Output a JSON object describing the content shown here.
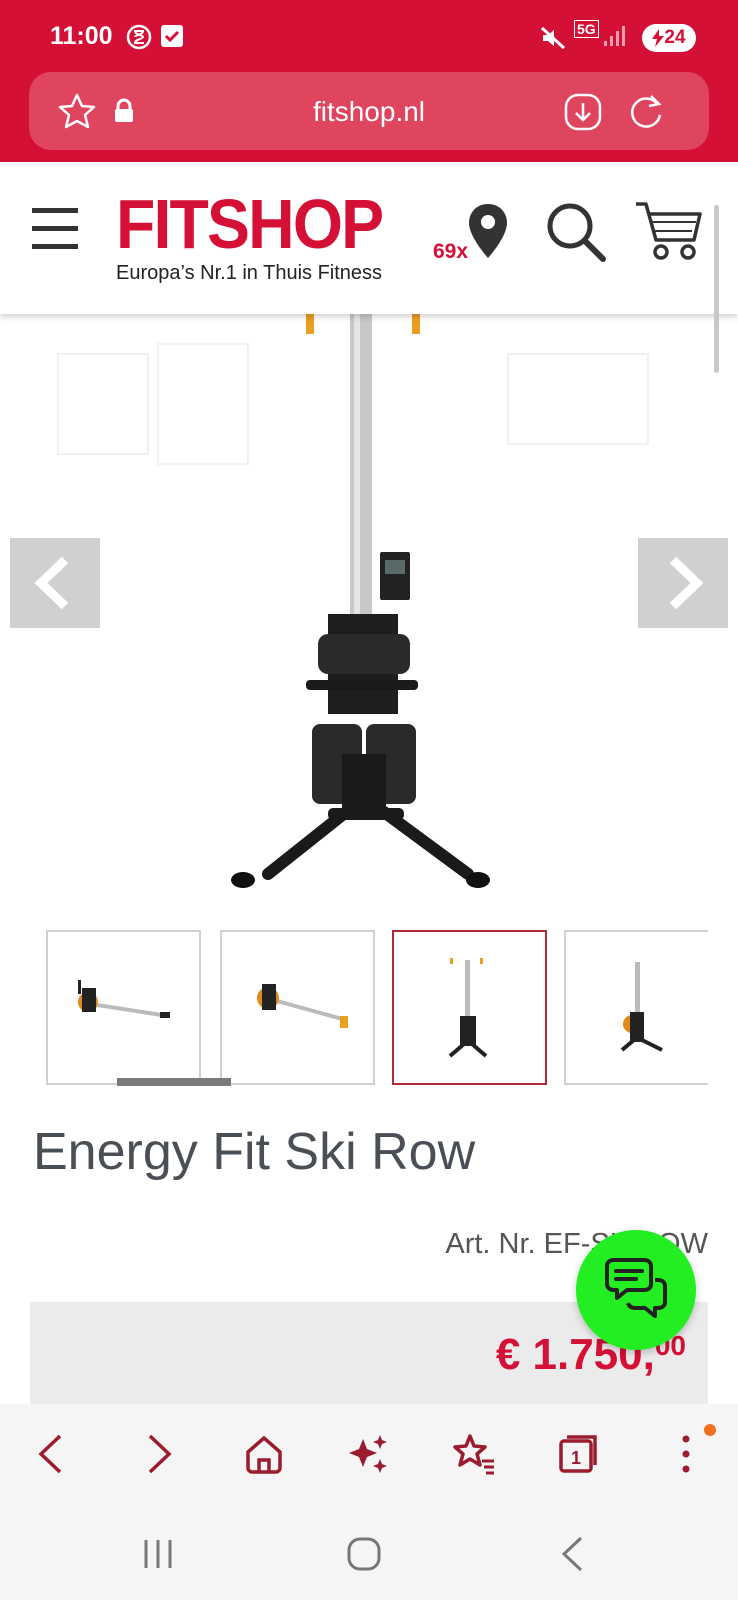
{
  "status_bar": {
    "time": "11:00",
    "network": "5G",
    "battery": "24"
  },
  "browser": {
    "url": "fitshop.nl"
  },
  "header": {
    "logo_text": "FITSHOP",
    "tagline": "Europa’s Nr.1 in Thuis Fitness",
    "store_count": "69x"
  },
  "product": {
    "title": "Energy Fit Ski Row",
    "article_number": "Art. Nr. EF-SKIROW",
    "price_main": "€ 1.750,",
    "price_cents": "00",
    "gallery": {
      "thumbnail_count": 4,
      "active_thumbnail": 3
    }
  },
  "colors": {
    "brand_red": "#d51036",
    "chat_green": "#22ee22",
    "price_red": "#d51036"
  },
  "icons": {
    "toolbar": [
      "back-icon",
      "forward-icon",
      "home-icon",
      "sparkle-icon",
      "bookmarks-icon",
      "tabs-icon",
      "more-icon"
    ],
    "header": [
      "menu-icon",
      "location-pin-icon",
      "search-icon",
      "cart-icon"
    ]
  },
  "toolbar": {
    "tabs_count": "1"
  }
}
